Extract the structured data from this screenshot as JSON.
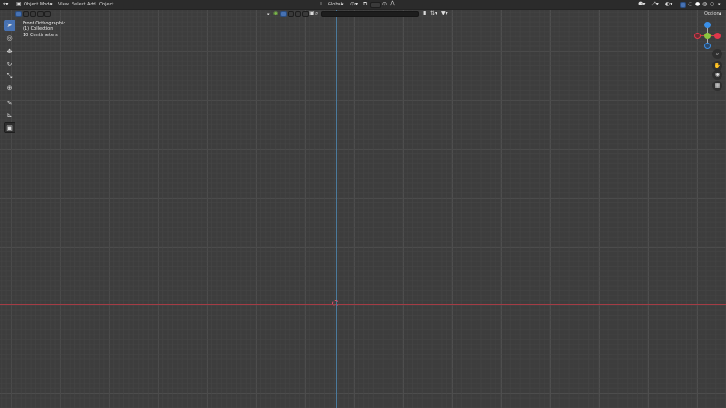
{
  "menubar": {
    "mode_label": "Object Mode",
    "menus": [
      "View",
      "Select",
      "Add",
      "Object"
    ],
    "transform_orientation": "Global",
    "options_label": "Options"
  },
  "viewport_info": {
    "view_name": "Front Orthographic",
    "collection": "(1) Collection",
    "grid_scale": "10 Centimeters"
  },
  "colors": {
    "x_axis": "#a43c45",
    "z_axis": "#4b7a9c",
    "active_tool": "#4772b3",
    "gizmo_x": "#e0374b",
    "gizmo_y": "#8cc63f",
    "gizmo_z": "#3a8fe8"
  },
  "toolbar": {
    "tools": [
      "select-box-icon",
      "cursor-icon",
      "move-icon",
      "rotate-icon",
      "scale-icon",
      "transform-icon",
      "annotate-icon",
      "measure-icon",
      "add-cube-icon"
    ]
  }
}
